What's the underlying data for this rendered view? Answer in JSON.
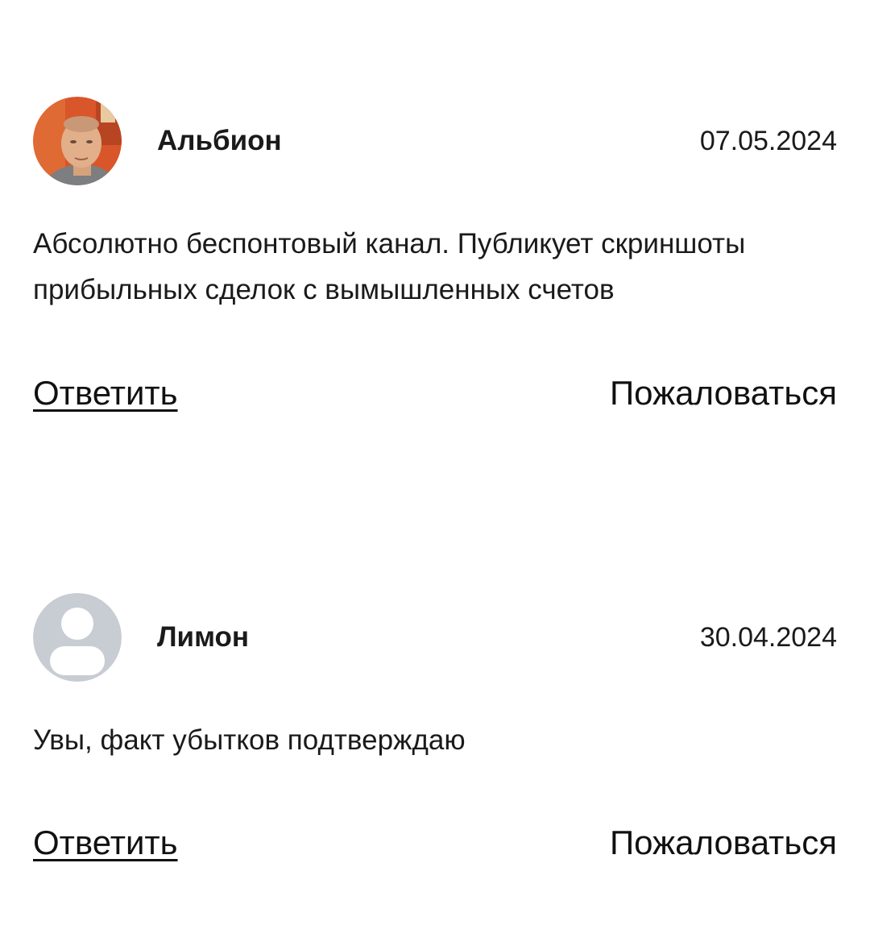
{
  "comments": [
    {
      "author": "Альбион",
      "date": "07.05.2024",
      "text_lines": [
        "Абсолютно беспонтовый канал. Публикует скриншоты",
        "прибыльных сделок с вымышленных счетов"
      ],
      "reply_label": "Ответить",
      "report_label": "Пожаловаться",
      "avatar_icon": "user-photo-icon"
    },
    {
      "author": "Лимон",
      "date": "30.04.2024",
      "text_lines": [
        "Увы, факт убытков подтверждаю"
      ],
      "reply_label": "Ответить",
      "report_label": "Пожаловаться",
      "avatar_icon": "default-user-icon"
    }
  ],
  "colors": {
    "text": "#1a1a1a",
    "placeholder_avatar_bg": "#c8ccd3",
    "placeholder_avatar_fg": "#ffffff"
  }
}
